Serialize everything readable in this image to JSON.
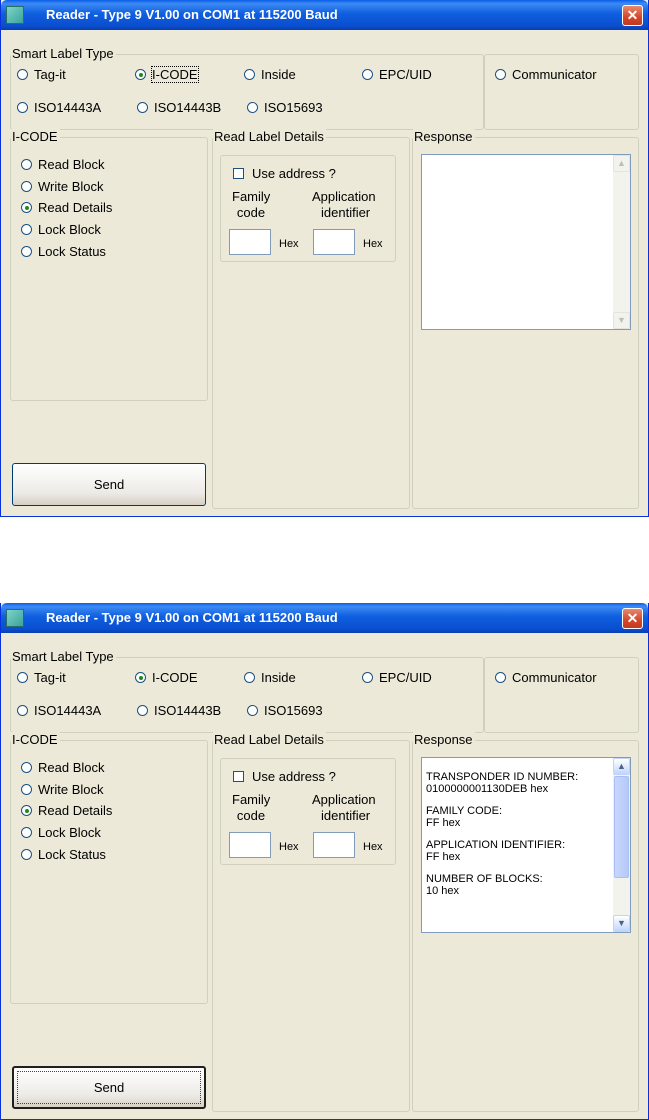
{
  "window_title": "Reader - Type 9 V1.00 on COM1 at 115200 Baud",
  "close_glyph": "✕",
  "smart_label_type": {
    "label": "Smart Label Type",
    "options": [
      {
        "label": "Tag-it",
        "selected": false
      },
      {
        "label": "I-CODE",
        "selected": true
      },
      {
        "label": "Inside",
        "selected": false
      },
      {
        "label": "EPC/UID",
        "selected": false
      },
      {
        "label": "Communicator",
        "selected": false
      },
      {
        "label": "ISO14443A",
        "selected": false
      },
      {
        "label": "ISO14443B",
        "selected": false
      },
      {
        "label": "ISO15693",
        "selected": false
      }
    ]
  },
  "icode": {
    "label": "I-CODE",
    "options": [
      {
        "label": "Read Block",
        "selected": false
      },
      {
        "label": "Write Block",
        "selected": false
      },
      {
        "label": "Read Details",
        "selected": true
      },
      {
        "label": "Lock Block",
        "selected": false
      },
      {
        "label": "Lock Status",
        "selected": false
      }
    ]
  },
  "read_label_details": {
    "label": "Read Label Details",
    "use_address_label": "Use address ?",
    "family_code_line1": "Family",
    "family_code_line2": "code",
    "app_id_line1": "Application",
    "app_id_line2": "identifier",
    "hex_unit": "Hex",
    "family_code_value": "",
    "app_id_value": ""
  },
  "response": {
    "label": "Response",
    "lines_before": [],
    "lines_after": [
      "TRANSPONDER ID NUMBER:",
      "0100000001130DEB hex",
      "",
      "FAMILY CODE:",
      "FF hex",
      "",
      "APPLICATION IDENTIFIER:",
      "FF hex",
      "",
      "NUMBER OF BLOCKS:",
      "10 hex"
    ]
  },
  "send_label": "Send"
}
